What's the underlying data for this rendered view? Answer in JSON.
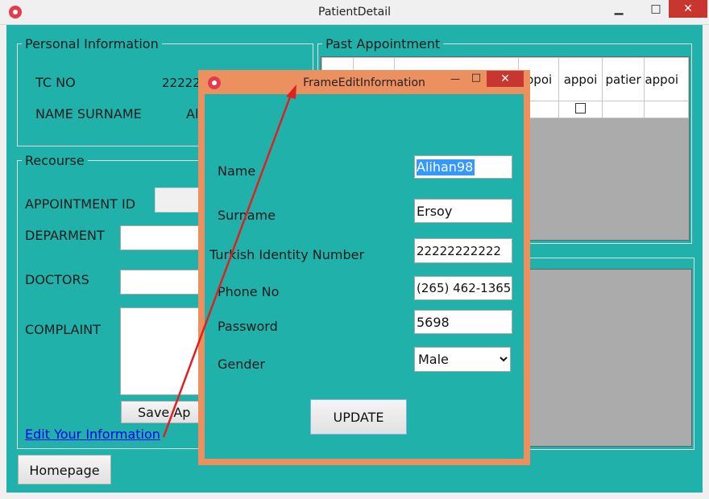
{
  "window": {
    "title": "PatientDetail",
    "minimize": "▁",
    "maximize": "□",
    "close": "✕"
  },
  "personal": {
    "legend": "Personal Information",
    "tc_label": "TC NO",
    "tc_value": "22222",
    "name_label": "NAME SURNAME",
    "name_value": "Al"
  },
  "recourse": {
    "legend": "Recourse",
    "appointment_id_label": "APPOINTMENT ID",
    "department_label": "DEPARMENT",
    "doctors_label": "DOCTORS",
    "complaint_label": "COMPLAINT",
    "save_button": "Save Ap",
    "edit_link": "Edit Your Information"
  },
  "past": {
    "legend": "Past Appointment",
    "columns": [
      "",
      "",
      "appoi appoi",
      "appoi",
      "appoi",
      "patier",
      "appoi"
    ]
  },
  "homepage_button": "Homepage",
  "dialog": {
    "title": "FrameEditInformation",
    "minimize": "—",
    "maximize": "□",
    "close": "✕",
    "labels": {
      "name": "Name",
      "surname": "Surname",
      "tin": "Turkish Identity Number",
      "phone": "Phone No",
      "password": "Password",
      "gender": "Gender"
    },
    "values": {
      "name": "Alihan98",
      "surname": "Ersoy",
      "tin": "22222222222",
      "phone": "(265) 462-1365",
      "password": "5698",
      "gender": "Male"
    },
    "update_button": "UPDATE"
  },
  "colors": {
    "background": "#20b2aa",
    "dialog_frame": "#ed9060",
    "close_button": "#c7372f",
    "arrow": "#e02020"
  }
}
